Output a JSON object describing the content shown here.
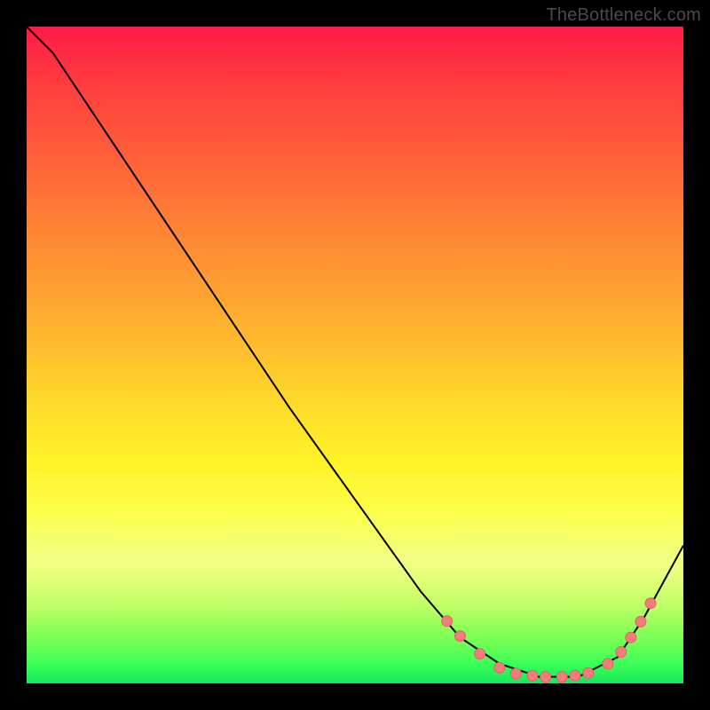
{
  "watermark": "TheBottleneck.com",
  "colors": {
    "frame_bg": "#000000",
    "curve_stroke": "#000000",
    "marker_fill": "#f47c7c",
    "marker_stroke": "#e46060"
  },
  "chart_data": {
    "type": "line",
    "title": "",
    "xlabel": "",
    "ylabel": "",
    "xlim": [
      0,
      1
    ],
    "ylim": [
      0,
      1
    ],
    "grid": false,
    "legend": false,
    "series": [
      {
        "name": "bottleneck-curve",
        "x": [
          0.0,
          0.04,
          0.1,
          0.2,
          0.3,
          0.4,
          0.5,
          0.6,
          0.66,
          0.72,
          0.78,
          0.84,
          0.9,
          0.94,
          1.0
        ],
        "y": [
          1.0,
          0.96,
          0.87,
          0.72,
          0.57,
          0.42,
          0.28,
          0.14,
          0.07,
          0.03,
          0.01,
          0.01,
          0.04,
          0.1,
          0.21
        ]
      }
    ],
    "markers": [
      {
        "name": "pt-a",
        "x": 0.64,
        "y": 0.095
      },
      {
        "name": "pt-b",
        "x": 0.66,
        "y": 0.072
      },
      {
        "name": "pt-c",
        "x": 0.69,
        "y": 0.045
      },
      {
        "name": "pt-d",
        "x": 0.72,
        "y": 0.024
      },
      {
        "name": "pt-e",
        "x": 0.745,
        "y": 0.015
      },
      {
        "name": "pt-f",
        "x": 0.77,
        "y": 0.012
      },
      {
        "name": "pt-g",
        "x": 0.79,
        "y": 0.01
      },
      {
        "name": "pt-h",
        "x": 0.815,
        "y": 0.01
      },
      {
        "name": "pt-i",
        "x": 0.835,
        "y": 0.012
      },
      {
        "name": "pt-j",
        "x": 0.855,
        "y": 0.016
      },
      {
        "name": "pt-k",
        "x": 0.885,
        "y": 0.03
      },
      {
        "name": "pt-l",
        "x": 0.905,
        "y": 0.048
      },
      {
        "name": "pt-m",
        "x": 0.92,
        "y": 0.07
      },
      {
        "name": "pt-n",
        "x": 0.935,
        "y": 0.094
      },
      {
        "name": "pt-o",
        "x": 0.95,
        "y": 0.122
      }
    ]
  }
}
